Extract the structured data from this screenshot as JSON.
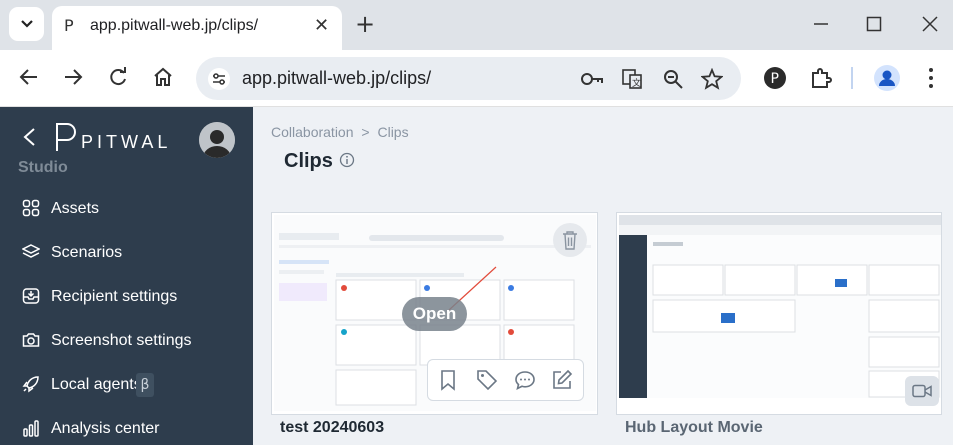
{
  "browser": {
    "tab_title": "app.pitwall-web.jp/clips/",
    "tab_favicon": "P",
    "url": "app.pitwall-web.jp/clips/",
    "new_tab_label": "+",
    "close_label": "✕"
  },
  "sidebar": {
    "logo_text": "PITWALL",
    "studio_label": "Studio",
    "items": [
      {
        "label": "Assets",
        "icon": "grid-icon"
      },
      {
        "label": "Scenarios",
        "icon": "layers-icon"
      },
      {
        "label": "Recipient settings",
        "icon": "inbox-icon"
      },
      {
        "label": "Screenshot settings",
        "icon": "camera-icon"
      },
      {
        "label": "Local agents",
        "icon": "rocket-icon",
        "badge": "β"
      },
      {
        "label": "Analysis center",
        "icon": "bar-chart-icon"
      }
    ]
  },
  "main": {
    "breadcrumb": [
      "Collaboration",
      "Clips"
    ],
    "breadcrumb_separator": ">",
    "title": "Clips",
    "cards": [
      {
        "title": "test 20240603",
        "open_label": "Open"
      },
      {
        "title": "Hub Layout Movie"
      }
    ]
  },
  "colors": {
    "sidebar_bg": "#2e3d4d",
    "main_bg": "#eef1f5",
    "card_title_dark": "#1f2933",
    "card_title_muted": "#5a6673"
  }
}
